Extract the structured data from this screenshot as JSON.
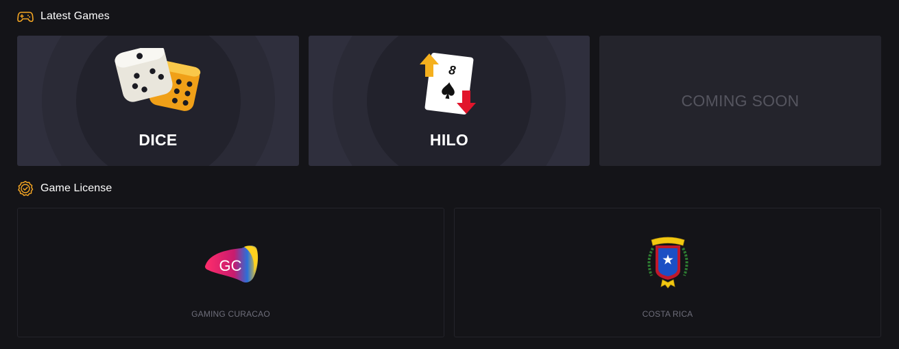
{
  "colors": {
    "background": "#141418",
    "card_active": "#2f2f3d",
    "card_placeholder": "#24242c",
    "accent": "#f5a623",
    "muted_text": "#6e6e7a"
  },
  "latest_games": {
    "title": "Latest Games",
    "icon": "gamepad-icon",
    "cards": [
      {
        "label": "DICE",
        "art": "dice-illustration",
        "status": "available"
      },
      {
        "label": "HILO",
        "art": "playing-card-illustration",
        "card_rank": "8",
        "status": "available"
      },
      {
        "label": "COMING SOON",
        "status": "placeholder"
      }
    ]
  },
  "game_license": {
    "title": "Game License",
    "icon": "verified-badge-icon",
    "licenses": [
      {
        "name": "GAMING CURACAO",
        "logo": "gc-logo",
        "logo_text": "GC"
      },
      {
        "name": "COSTA RICA",
        "logo": "costa-rica-coat-of-arms"
      }
    ]
  }
}
